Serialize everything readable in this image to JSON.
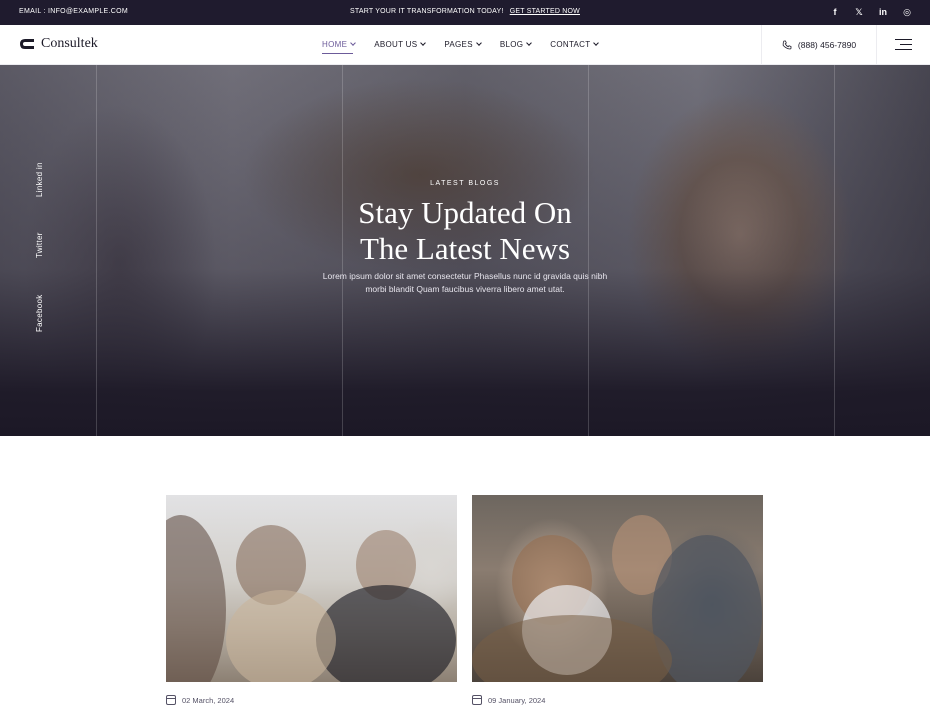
{
  "topbar": {
    "email": "EMAIL : INFO@EXAMPLE.COM",
    "promo_text": "START YOUR IT TRANSFORMATION TODAY!",
    "promo_link": "GET STARTED NOW",
    "social": [
      "f",
      "𝕏",
      "in",
      "◎"
    ]
  },
  "header": {
    "logo_text": "Consultek",
    "nav": [
      {
        "label": "HOME"
      },
      {
        "label": "ABOUT US"
      },
      {
        "label": "PAGES"
      },
      {
        "label": "BLOG"
      },
      {
        "label": "CONTACT"
      }
    ],
    "phone": "(888) 456-7890"
  },
  "hero": {
    "social_links": [
      "Linked in",
      "Twitter",
      "Facebook"
    ],
    "eyebrow": "LATEST BLOGS",
    "title_line1": "Stay Updated On",
    "title_line2": "The Latest News",
    "description": "Lorem ipsum dolor sit amet consectetur Phasellus nunc id gravida quis nibh morbi blandit Quam faucibus viverra libero amet utat."
  },
  "posts": [
    {
      "date": "02 March, 2024"
    },
    {
      "date": "09 January, 2024"
    }
  ],
  "colors": {
    "topbar_bg": "#1f1b2e",
    "accent": "#6c5b9a",
    "hero_overlay": "#1c1826"
  }
}
